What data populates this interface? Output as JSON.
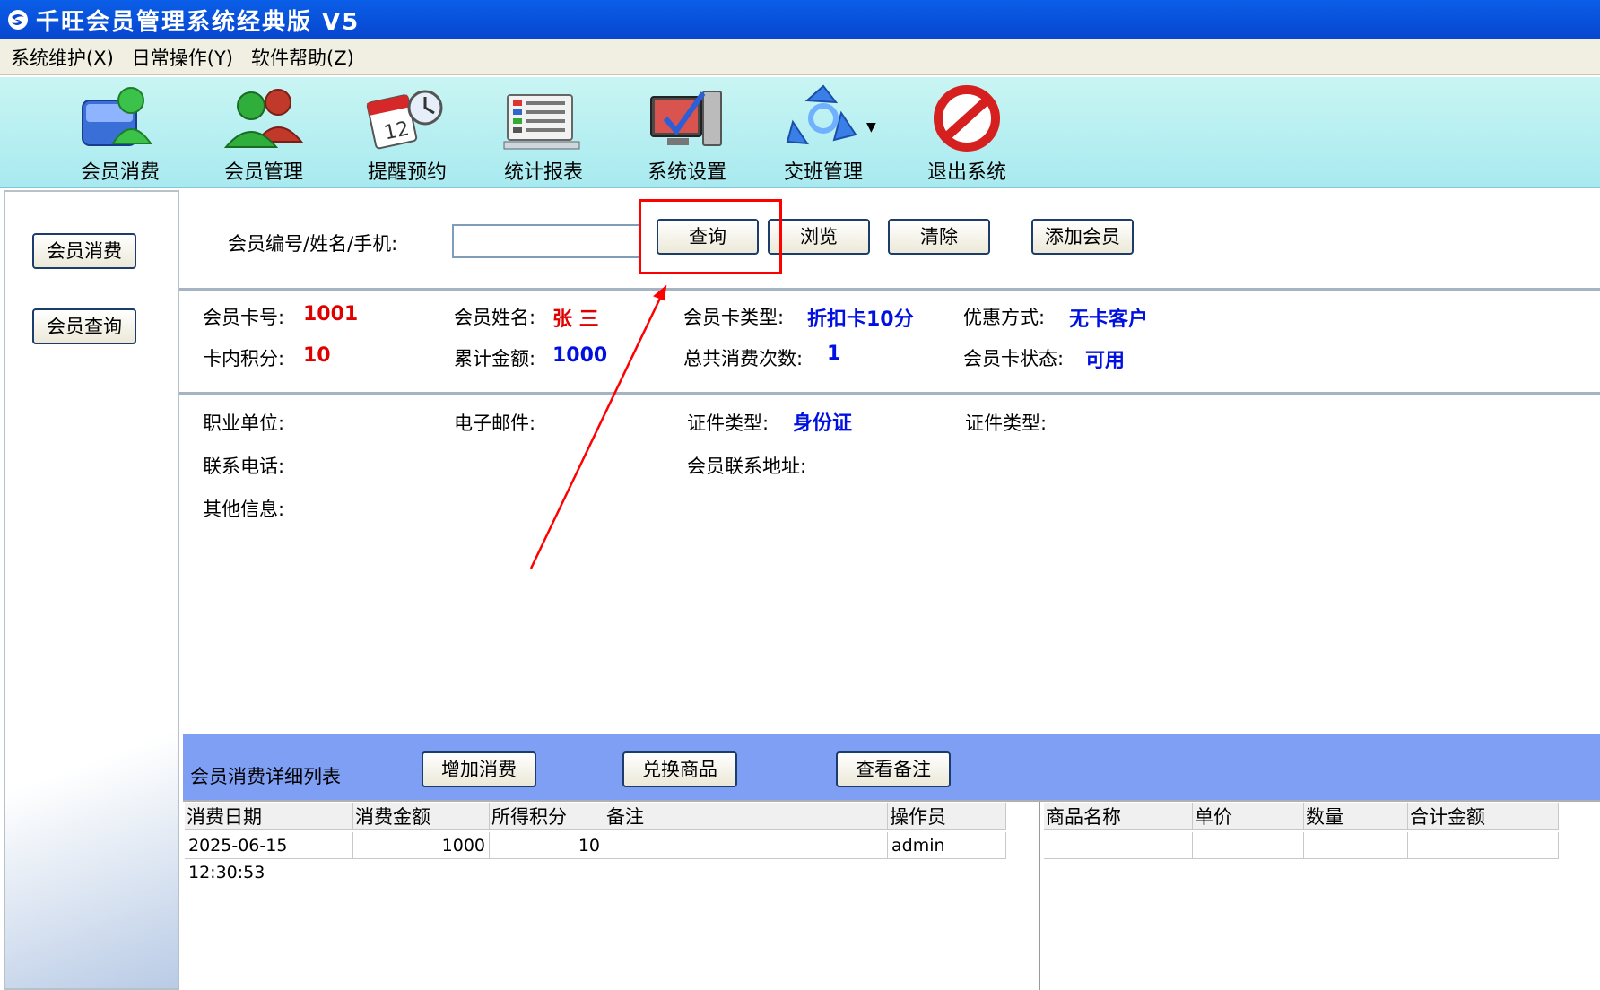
{
  "window": {
    "title": "千旺会员管理系统经典版 V5"
  },
  "menu": [
    "系统维护(X)",
    "日常操作(Y)",
    "软件帮助(Z)"
  ],
  "toolbar": [
    {
      "label": "会员消费",
      "icon": "member-consume-icon"
    },
    {
      "label": "会员管理",
      "icon": "member-manage-icon"
    },
    {
      "label": "提醒预约",
      "icon": "calendar-clock-icon"
    },
    {
      "label": "统计报表",
      "icon": "report-icon"
    },
    {
      "label": "系统设置",
      "icon": "settings-icon"
    },
    {
      "label": "交班管理",
      "icon": "recycle-icon"
    },
    {
      "label": "退出系统",
      "icon": "exit-icon"
    }
  ],
  "left": {
    "btn1": "会员消费",
    "btn2": "会员查询"
  },
  "search": {
    "label": "会员编号/姓名/手机:",
    "value": "",
    "query": "查询",
    "browse": "浏览",
    "clear": "清除",
    "add_member": "添加会员"
  },
  "info": {
    "card_no_label": "会员卡号:",
    "card_no": "1001",
    "name_label": "会员姓名:",
    "name": "张 三",
    "card_type_label": "会员卡类型:",
    "card_type": "折扣卡10分",
    "discount_label": "优惠方式:",
    "discount": "无卡客户",
    "points_label": "卡内积分:",
    "points": "10",
    "total_label": "累计金额:",
    "total": "1000",
    "count_label": "总共消费次数:",
    "count": "1",
    "status_label": "会员卡状态:",
    "status": "可用"
  },
  "detail": {
    "job_label": "职业单位:",
    "email_label": "电子邮件:",
    "id_type_label": "证件类型:",
    "id_type": "身份证",
    "id_type2_label": "证件类型:",
    "phone_label": "联系电话:",
    "address_label": "会员联系地址:",
    "other_label": "其他信息:"
  },
  "list": {
    "title": "会员消费详细列表",
    "add": "增加消费",
    "exchange": "兑换商品",
    "remark": "查看备注",
    "columns": [
      "消费日期",
      "消费金额",
      "所得积分",
      "备注",
      "操作员"
    ],
    "rows": [
      [
        "2025-06-15 12:30:53",
        "1000",
        "10",
        "",
        "admin"
      ]
    ],
    "goods_columns": [
      "商品名称",
      "单价",
      "数量",
      "合计金额"
    ]
  },
  "colors": {
    "title": "#0a5ee8",
    "highlight": "#ff0000",
    "value_red": "#e00000",
    "value_blue": "#0010e0",
    "list_header": "#7f9ff4"
  }
}
